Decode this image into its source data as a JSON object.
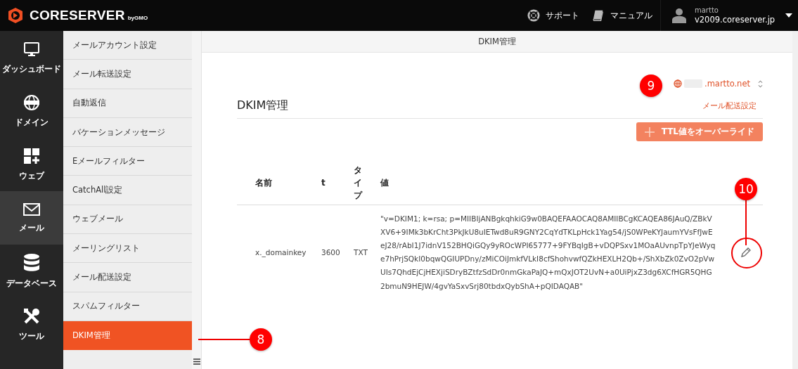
{
  "header": {
    "logo": "CORESERVER",
    "logo_sub": "byGMO",
    "links": [
      {
        "kind": "support",
        "label": "サポート"
      },
      {
        "kind": "manual",
        "label": "マニュアル"
      }
    ],
    "user": {
      "name": "martto",
      "server": "v2009.coreserver.jp"
    }
  },
  "nav": [
    {
      "kind": "monitor",
      "label": "ダッシュボード",
      "selected": false
    },
    {
      "kind": "globe",
      "label": "ドメイン",
      "selected": false
    },
    {
      "kind": "grid",
      "label": "ウェブ",
      "selected": false
    },
    {
      "kind": "mail",
      "label": "メール",
      "selected": true
    },
    {
      "kind": "database",
      "label": "データベース",
      "selected": false
    },
    {
      "kind": "tools",
      "label": "ツール",
      "selected": false
    }
  ],
  "submenu": [
    {
      "label": "メールアカウント設定",
      "selected": false
    },
    {
      "label": "メール転送設定",
      "selected": false
    },
    {
      "label": "自動返信",
      "selected": false
    },
    {
      "label": "バケーションメッセージ",
      "selected": false
    },
    {
      "label": "Eメールフィルター",
      "selected": false
    },
    {
      "label": "CatchAll設定",
      "selected": false
    },
    {
      "label": "ウェブメール",
      "selected": false
    },
    {
      "label": "メーリングリスト",
      "selected": false
    },
    {
      "label": "メール配送設定",
      "selected": false
    },
    {
      "label": "スパムフィルター",
      "selected": false
    },
    {
      "label": "DKIM管理",
      "selected": true
    }
  ],
  "page_title": "DKIM管理",
  "domain_selector": {
    "value": ".martto.net"
  },
  "heading": "DKIM管理",
  "link": "メール配送設定",
  "ttl_button": "TTL値をオーバーライド",
  "table": {
    "columns": [
      "名前",
      "t",
      "タイプ",
      "値"
    ],
    "rows": [
      {
        "cells": [
          "x._domainkey",
          "3600",
          "TXT",
          "\"v=DKIM1; k=rsa; p=MIIBIjANBgkqhkiG9w0BAQEFAAOCAQ8AMIIBCgKCAQEA86JAuQ/ZBkVXV6+9IMk3bKrCht3PkJkU8uIETwd8uR9GNY2CqYdTKLpHck1Yag54/jS0WPeKYJaumYVsFfJwEeJ28/rAbI1J7idnV152BHQiGQy9yROcWPI65777+9FYBqIgB+vDQPSxv1MOaAUvnpTpYJeWyqe7hPrjSQkI0bqwQGIUPDny/zMiCOiJmkfVLkI8cfShohvwfQZkHEXLH2Qb+/ShXbZk0ZvO2pVwUIs7QhdEjCjHEXjiSDryBZtfzSdDr0nmGkaPaJQ+mQxJOT2UvN+a0UiPjxZ3dg6XCfHGR5QHG2bmuN9HEJW/4gvYaSxvSrj80tbdxQybShA+pQIDAQAB\""
        ]
      }
    ]
  },
  "callouts": [
    {
      "label": "9"
    },
    {
      "label": "10"
    },
    {
      "label": "8"
    }
  ]
}
